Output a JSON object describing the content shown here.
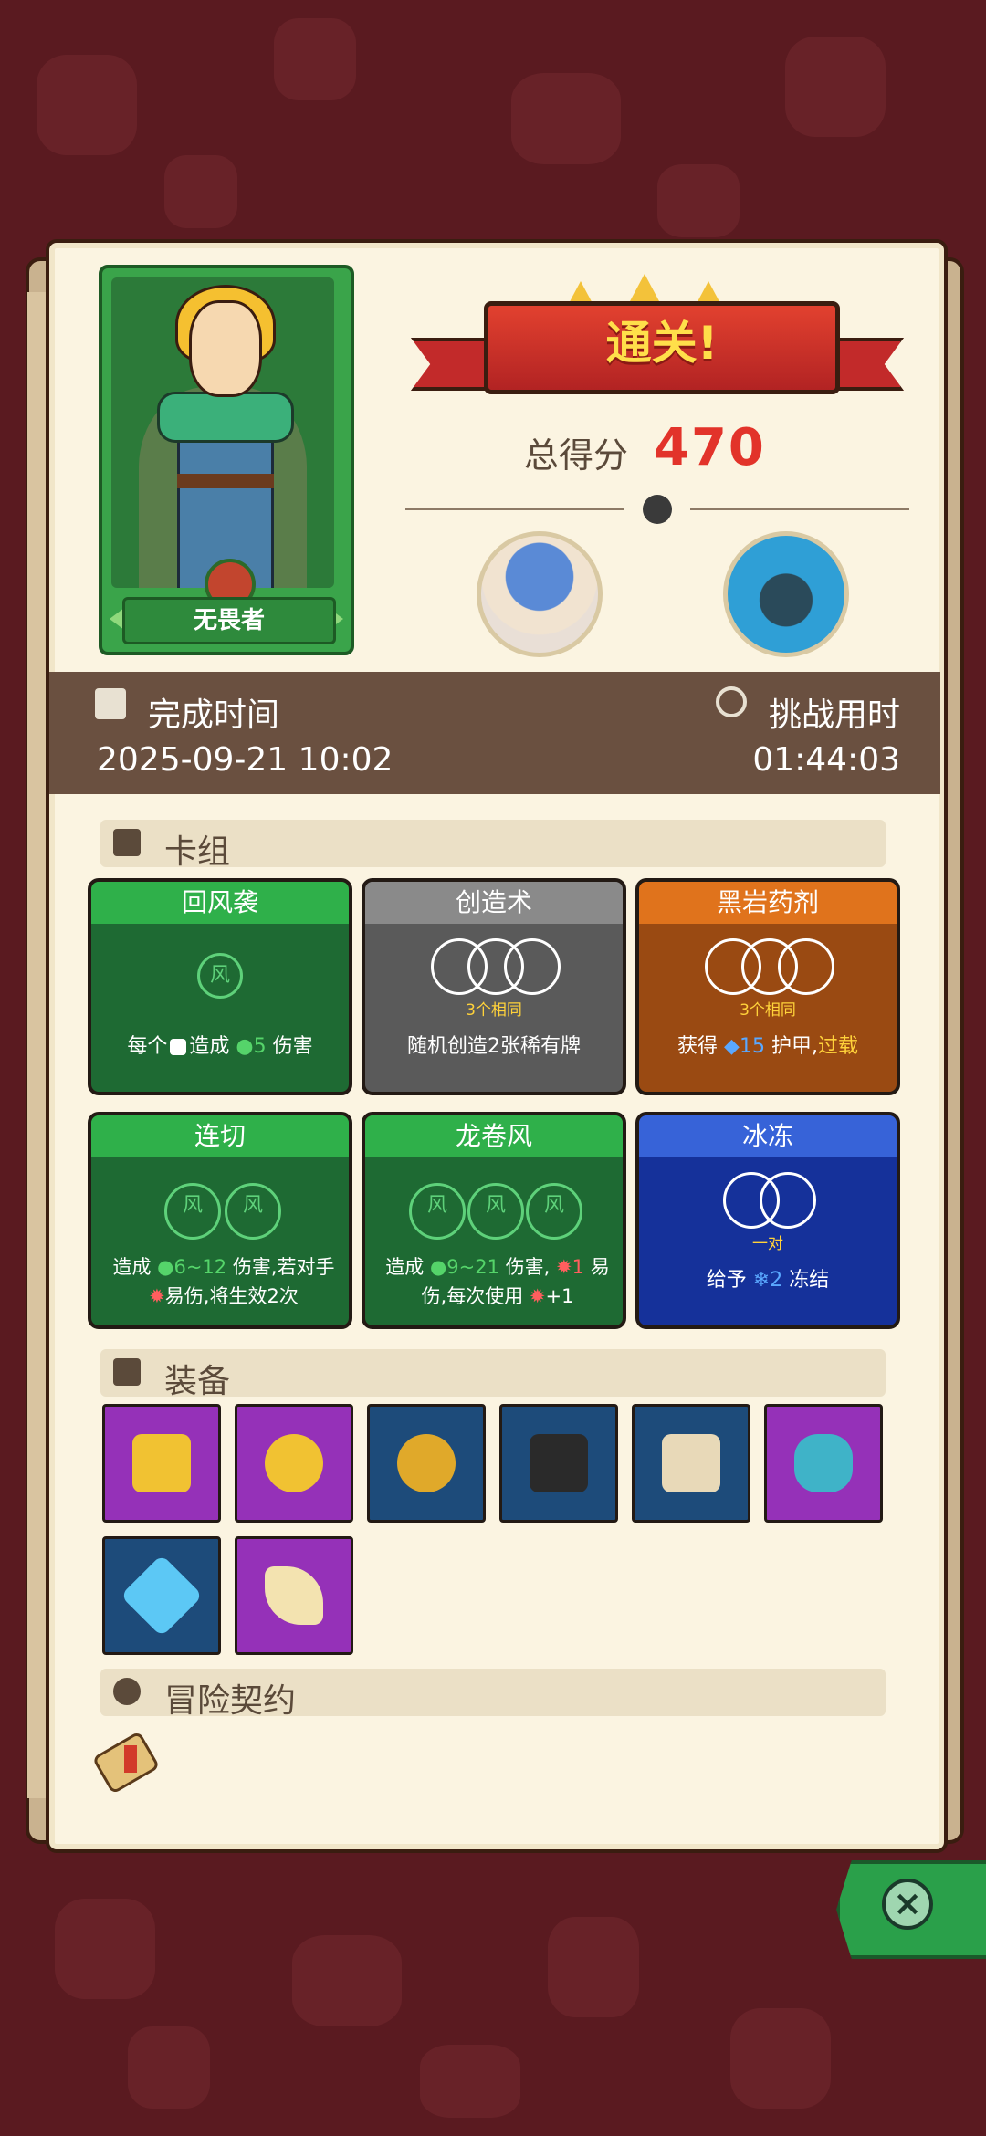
{
  "hero": {
    "name": "无畏者"
  },
  "result": {
    "banner": "通关!",
    "score_label": "总得分",
    "score_value": "470"
  },
  "stats": {
    "finish_time_label": "完成时间",
    "finish_time_value": "2025-09-21 10:02",
    "challenge_time_label": "挑战用时",
    "challenge_time_value": "01:44:03"
  },
  "sections": {
    "deck": "卡组",
    "equipment": "装备",
    "contract": "冒险契约"
  },
  "cards": [
    {
      "title": "回风袭",
      "desc_a": "每个",
      "desc_b": "造成",
      "desc_num": "5",
      "desc_c": "伤害"
    },
    {
      "title": "创造术",
      "sub": "3个相同",
      "desc": "随机创造2张稀有牌"
    },
    {
      "title": "黑岩药剂",
      "sub": "3个相同",
      "desc_a": "获得",
      "desc_num": "15",
      "desc_b": "护甲,",
      "desc_hl": "过载"
    },
    {
      "title": "连切",
      "line1_a": "造成",
      "line1_num": "6~12",
      "line1_b": "伤害,若对手",
      "line2_a": "易伤,将生效2次"
    },
    {
      "title": "龙卷风",
      "line1_a": "造成",
      "line1_num": "9~21",
      "line1_b": "伤害,",
      "line1_num2": "1",
      "line1_c": "易",
      "line2_a": "伤,每次使用",
      "line2_num": "+1"
    },
    {
      "title": "冰冻",
      "sub": "一对",
      "desc_a": "给予",
      "desc_num": "2",
      "desc_b": "冻结"
    }
  ],
  "equipment": [
    {
      "icon": "gold-bars-icon",
      "color": "#9531b8"
    },
    {
      "icon": "moon-star-icon",
      "color": "#9531b8"
    },
    {
      "icon": "gold-ring-icon",
      "color": "#1d4b7a"
    },
    {
      "icon": "magic-hat-dice-icon",
      "color": "#1d4b7a"
    },
    {
      "icon": "scroll-icon",
      "color": "#1d4b7a"
    },
    {
      "icon": "dragon-shield-icon",
      "color": "#9531b8"
    },
    {
      "icon": "blue-crystal-icon",
      "color": "#1d4b7a"
    },
    {
      "icon": "fangs-icon",
      "color": "#9531b8"
    }
  ],
  "contract": {
    "icon": "contract-scroll-icon"
  },
  "colors": {
    "background": "#5a1a20",
    "panel": "#fbf4e1",
    "score": "#e2332a",
    "close": "#2aa04a"
  }
}
